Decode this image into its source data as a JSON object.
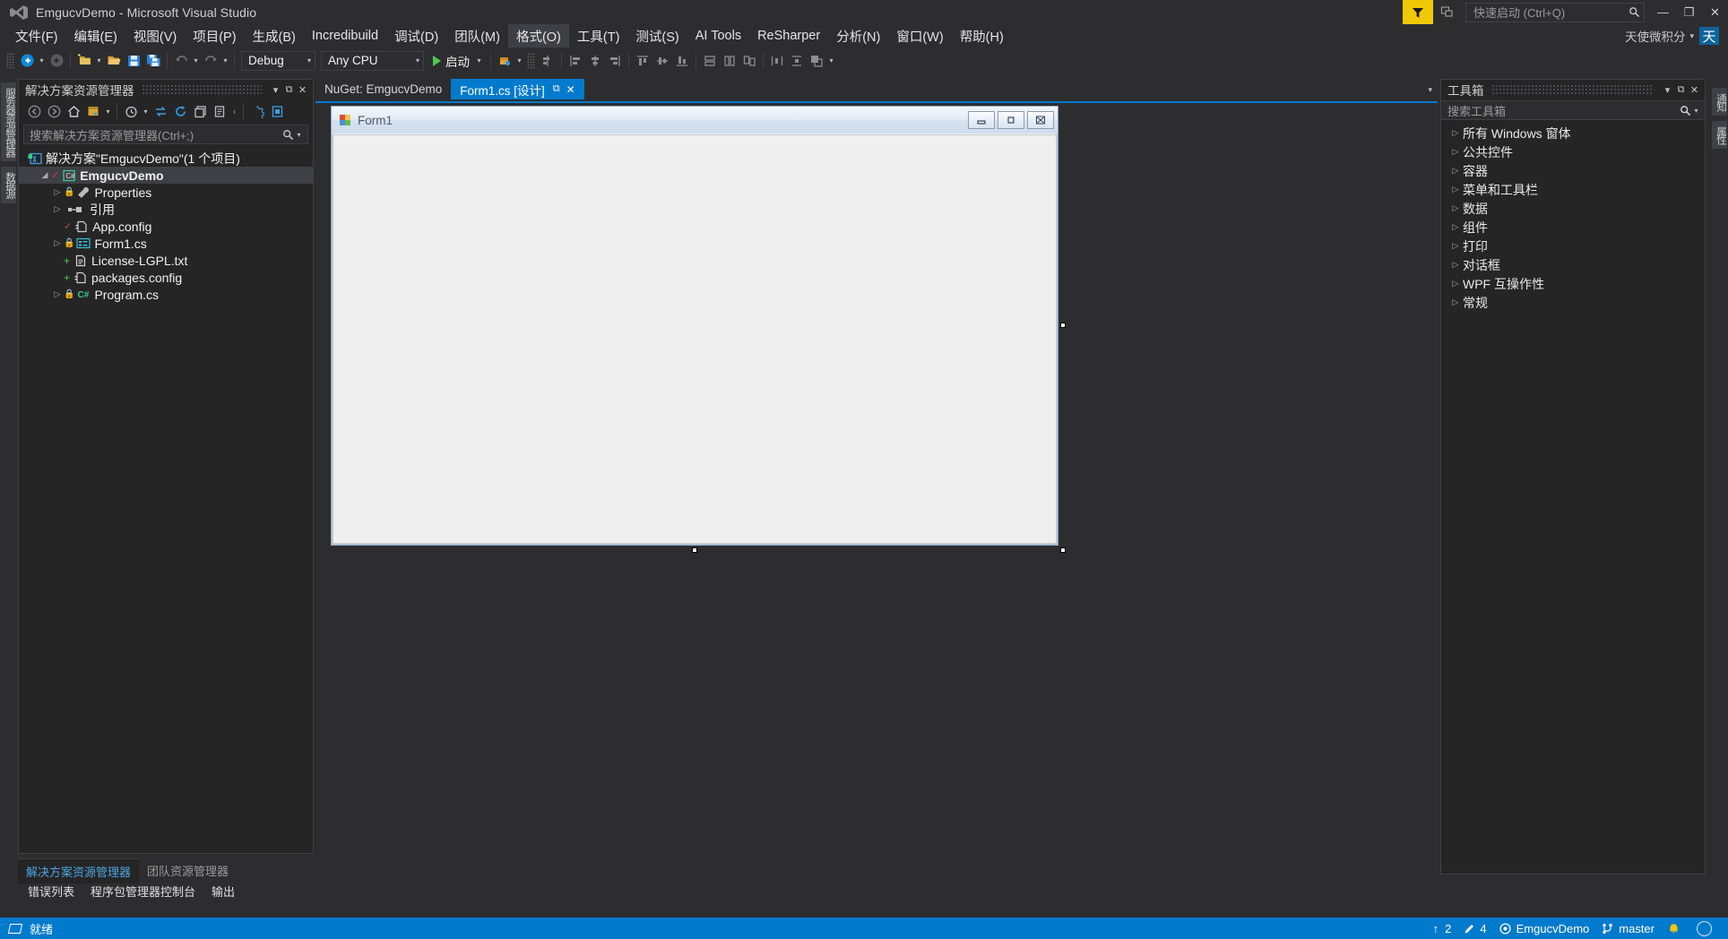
{
  "window": {
    "title": "EmgucvDemo - Microsoft Visual Studio",
    "logo_icon": "visual-studio-logo",
    "minimize_label": "—",
    "maximize_label": "❐",
    "close_label": "✕"
  },
  "quick_launch": {
    "placeholder": "快速启动 (Ctrl+Q)",
    "icon": "search-icon"
  },
  "feedback": {
    "icon": "feedback-funnel-icon"
  },
  "notifications": {
    "icon": "notification-flag-icon"
  },
  "account": {
    "name": "天使微积分",
    "avatar_initial": "天",
    "caret": "▾"
  },
  "menu": {
    "items": [
      {
        "label": "文件(F)",
        "active": false
      },
      {
        "label": "编辑(E)",
        "active": false
      },
      {
        "label": "视图(V)",
        "active": false
      },
      {
        "label": "项目(P)",
        "active": false
      },
      {
        "label": "生成(B)",
        "active": false
      },
      {
        "label": "Incredibuild",
        "active": false
      },
      {
        "label": "调试(D)",
        "active": false
      },
      {
        "label": "团队(M)",
        "active": false
      },
      {
        "label": "格式(O)",
        "active": true
      },
      {
        "label": "工具(T)",
        "active": false
      },
      {
        "label": "测试(S)",
        "active": false
      },
      {
        "label": "AI Tools",
        "active": false
      },
      {
        "label": "ReSharper",
        "active": false
      },
      {
        "label": "分析(N)",
        "active": false
      },
      {
        "label": "窗口(W)",
        "active": false
      },
      {
        "label": "帮助(H)",
        "active": false
      }
    ]
  },
  "toolbar": {
    "nav_back_icon": "navigate-back-icon",
    "nav_forward_icon": "navigate-forward-icon",
    "new_project_icon": "new-project-icon",
    "open_file_icon": "open-file-icon",
    "save_icon": "save-icon",
    "save_all_icon": "save-all-icon",
    "undo_icon": "undo-icon",
    "redo_icon": "redo-icon",
    "config_value": "Debug",
    "platform_value": "Any CPU",
    "start_label": "启动",
    "start_icon": "play-icon",
    "attach_icon": "attach-process-icon",
    "align_icons": [
      "align-lefts-icon",
      "align-centers-icon",
      "align-rights-icon",
      "align-tops-icon",
      "align-middles-icon",
      "align-bottoms-icon",
      "make-same-width-icon",
      "make-same-height-icon",
      "make-same-size-icon",
      "horizontal-spacing-icon",
      "vertical-spacing-icon"
    ]
  },
  "left_vertical_tabs": [
    {
      "label": "服务器资源管理器"
    },
    {
      "label": "数据源"
    }
  ],
  "right_vertical_tabs": [
    {
      "label": "通知"
    },
    {
      "label": "属性"
    }
  ],
  "solution_explorer": {
    "title": "解决方案资源管理器",
    "caret": "▾",
    "pin": "⧉",
    "close": "✕",
    "toolbar_icons": [
      "back-icon",
      "forward-icon",
      "home-icon",
      "switch-views-icon",
      "caret-down-icon",
      "pending-changes-icon",
      "caret-down-icon",
      "sync-with-active-document-icon",
      "refresh-icon",
      "collapse-all-icon",
      "show-all-files-icon",
      "properties-icon",
      "preview-icon"
    ],
    "search_placeholder": "搜索解决方案资源管理器(Ctrl+;)",
    "tree": [
      {
        "label": "解决方案\"EmgucvDemo\"(1 个项目)",
        "indent": 0,
        "arrow": "",
        "icon": "solution-icon",
        "bold": false,
        "selected": false,
        "badge": ""
      },
      {
        "label": "EmgucvDemo",
        "indent": 1,
        "arrow": "◢",
        "icon": "csharp-project-icon",
        "bold": true,
        "selected": true,
        "badge": "✓"
      },
      {
        "label": "Properties",
        "indent": 2,
        "arrow": "▷",
        "icon": "properties-folder-icon",
        "bold": false,
        "selected": false,
        "badge": ""
      },
      {
        "label": "引用",
        "indent": 2,
        "arrow": "▷",
        "icon": "references-icon",
        "bold": false,
        "selected": false,
        "badge": ""
      },
      {
        "label": "App.config",
        "indent": 3,
        "arrow": "",
        "icon": "config-file-icon",
        "bold": false,
        "selected": false,
        "badge": "✓"
      },
      {
        "label": "Form1.cs",
        "indent": 2,
        "arrow": "▷",
        "icon": "form-file-icon",
        "bold": false,
        "selected": false,
        "badge": ""
      },
      {
        "label": "License-LGPL.txt",
        "indent": 3,
        "arrow": "",
        "icon": "text-file-icon",
        "bold": false,
        "selected": false,
        "badge": "+"
      },
      {
        "label": "packages.config",
        "indent": 3,
        "arrow": "",
        "icon": "config-file-icon",
        "bold": false,
        "selected": false,
        "badge": "+"
      },
      {
        "label": "Program.cs",
        "indent": 2,
        "arrow": "▷",
        "icon": "csharp-file-icon",
        "bold": false,
        "selected": false,
        "badge": ""
      }
    ],
    "bottom_tabs": [
      {
        "label": "解决方案资源管理器",
        "active": true
      },
      {
        "label": "团队资源管理器",
        "active": false
      }
    ]
  },
  "bottom_panel_tabs": [
    {
      "label": "错误列表"
    },
    {
      "label": "程序包管理器控制台"
    },
    {
      "label": "输出"
    }
  ],
  "document_tabs": [
    {
      "label": "NuGet: EmgucvDemo",
      "active": false,
      "pin": "",
      "close": ""
    },
    {
      "label": "Form1.cs [设计]",
      "active": true,
      "pin": "⧉",
      "close": "✕"
    }
  ],
  "designer": {
    "form_title": "Form1",
    "form_icon": "winform-icon",
    "minimize_label": "–",
    "maximize_label": "□",
    "close_label": "✕"
  },
  "toolbox": {
    "title": "工具箱",
    "caret": "▾",
    "pin": "⧉",
    "close": "✕",
    "search_placeholder": "搜索工具箱",
    "search_icon": "search-icon",
    "items": [
      {
        "label": "所有 Windows 窗体"
      },
      {
        "label": "公共控件"
      },
      {
        "label": "容器"
      },
      {
        "label": "菜单和工具栏"
      },
      {
        "label": "数据"
      },
      {
        "label": "组件"
      },
      {
        "label": "打印"
      },
      {
        "label": "对话框"
      },
      {
        "label": "WPF 互操作性"
      },
      {
        "label": "常规"
      }
    ]
  },
  "status_bar": {
    "icon": "ready-icon",
    "ready_label": "就绪",
    "up_arrow": "↑",
    "up_count": "2",
    "pending_icon": "pencil-icon",
    "pending_count": "4",
    "repo_icon": "source-control-icon",
    "repo_name": "EmgucvDemo",
    "branch_icon": "branch-icon",
    "branch_name": "master",
    "notify_icon": "notification-bell-icon",
    "avatar_icon": "user-avatar-icon"
  },
  "colors": {
    "accent": "#007acc",
    "chrome": "#2d2d30",
    "panel": "#252526",
    "border": "#3f3f46",
    "feedback": "#f0c808",
    "selection": "#3f3f46"
  }
}
